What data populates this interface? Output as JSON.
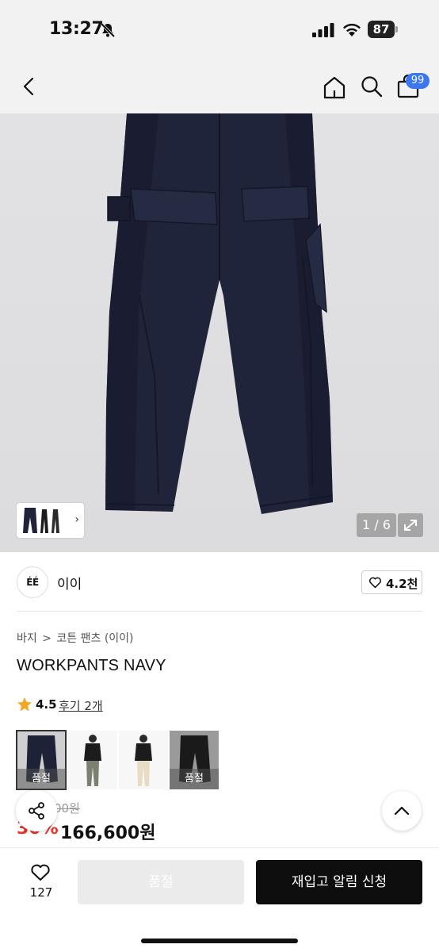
{
  "status_bar": {
    "time": "13:27",
    "battery": "87",
    "icons": [
      "bell-slash-icon",
      "signal-icon",
      "wifi-icon",
      "battery-icon"
    ]
  },
  "header": {
    "icons": [
      "back-icon",
      "home-icon",
      "search-icon",
      "cart-icon"
    ],
    "cart_count": "99",
    "badge_color": "#3b78f0"
  },
  "gallery": {
    "counter": "1 / 6",
    "current_index": 1,
    "total": 6
  },
  "brand": {
    "logo_text": "ÉÉ",
    "name": "이이",
    "likes": "4.2천"
  },
  "breadcrumb": {
    "items": [
      "바지",
      "코튼 팬츠 (이이)"
    ],
    "separator": ">"
  },
  "product": {
    "title": "WORKPANTS NAVY",
    "rating": "4.5",
    "reviews": "후기 2개",
    "swatches": [
      {
        "label": "품절",
        "sold_out": true,
        "selected": true
      },
      {
        "label": "",
        "sold_out": false,
        "selected": false
      },
      {
        "label": "",
        "sold_out": false,
        "selected": false
      },
      {
        "label": "품절",
        "sold_out": true,
        "selected": false
      }
    ],
    "original_price": "00원",
    "discount": "30%",
    "price": "166,600원",
    "discount_color": "#e8332c"
  },
  "bottom_bar": {
    "wish_count": "127",
    "soldout_label": "품절",
    "restock_label": "재입고 알림 신청"
  }
}
